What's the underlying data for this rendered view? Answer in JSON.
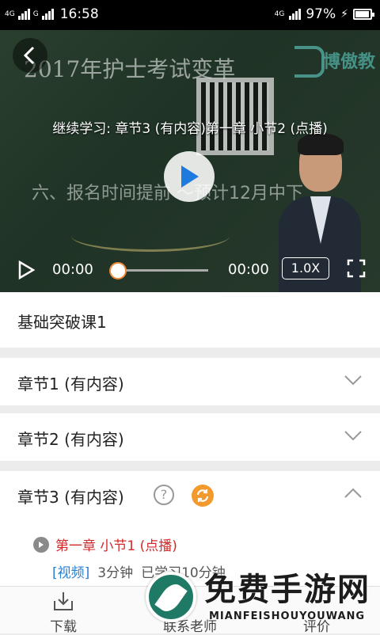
{
  "status_bar": {
    "signal1_label": "4G",
    "signal2_label": "G",
    "time": "16:58",
    "signal3_label": "4G",
    "battery": "97%"
  },
  "video": {
    "board_title": "2017年护士考试变革",
    "board_logo_text": "博傲教",
    "board_line": "六、报名时间提前 ～预计12月中下",
    "title": "继续学习: 章节3 (有内容)第一章 小节2 (点播)",
    "current_time": "00:00",
    "total_time": "00:00",
    "progress": 0,
    "speed": "1.0X"
  },
  "course": {
    "name": "基础突破课1"
  },
  "chapters": [
    {
      "label": "章节1 (有内容)",
      "expanded": false
    },
    {
      "label": "章节2  (有内容)",
      "expanded": false
    },
    {
      "label": "章节3 (有内容)",
      "expanded": true,
      "lesson": {
        "title": "第一章 小节1 (点播)",
        "type_tag": "[视频]",
        "duration": "3分钟",
        "studied": "已学习10分钟"
      }
    }
  ],
  "tabs": [
    {
      "label": "下载",
      "icon": "download-icon"
    },
    {
      "label": "联系老师",
      "icon": "teacher-icon"
    },
    {
      "label": "评价",
      "icon": "rate-icon"
    }
  ],
  "watermark": {
    "cn": "免费手游网",
    "en": "MIANFEISHOUYOUWANG"
  },
  "colors": {
    "accent_orange": "#f29a2e",
    "lesson_red": "#d22a2a",
    "tag_blue": "#2b7fd0",
    "play_blue": "#1f7ae0"
  }
}
